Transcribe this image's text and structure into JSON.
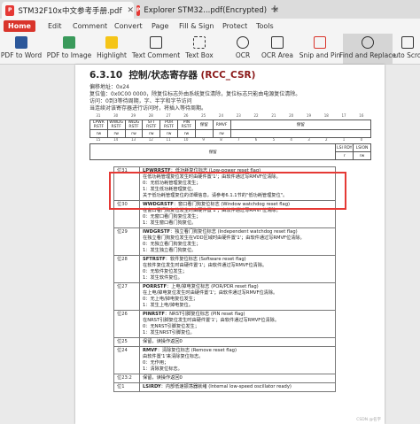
{
  "tabs": [
    {
      "label": "STM32F10x中文参考手册.pdf",
      "icon": "pdf-icon"
    },
    {
      "label": "Explorer STM32...pdf(Encrypted)",
      "icon": "pdf-icon"
    }
  ],
  "new_tab": "+",
  "menu": [
    "Home",
    "Edit",
    "Comment",
    "Convert",
    "Page",
    "Fill & Sign",
    "Protect",
    "Tools"
  ],
  "toolbar": [
    "PDF to Word",
    "PDF to Image",
    "Highlight",
    "Text Comment",
    "Text Box",
    "OCR",
    "OCR Area",
    "Snip and Pin",
    "Find and Replace",
    "Auto Scroll"
  ],
  "doc": {
    "section_num": "6.3.10",
    "section_title": "控制/状态寄存器",
    "section_reg": "(RCC_CSR)",
    "offset": "偏移地址：0x24",
    "reset": "复位值：0x0C00 0000，除复位标志外由系统复位清除，复位标志只能由电源复位清除。",
    "access": "访问：0到3等待周期，字、半字和字节访问",
    "note": "当连续对该寄存器进行访问时，将插入等待周期。",
    "bits_top": [
      "31",
      "30",
      "29",
      "28",
      "27",
      "26",
      "25",
      "24",
      "23",
      "22",
      "21",
      "20",
      "19",
      "18",
      "17",
      "16"
    ],
    "row1": [
      "LPWR RSTF",
      "WWDG RSTF",
      "IWDG RSTF",
      "SFT RSTF",
      "POR RSTF",
      "PIN RSTF",
      "保留",
      "RMVF",
      "保留"
    ],
    "row1_access": [
      "rw",
      "rw",
      "rw",
      "rw",
      "rw",
      "rw",
      "",
      "rw",
      ""
    ],
    "bits_bot": [
      "15",
      "14",
      "13",
      "12",
      "11",
      "10",
      "9",
      "8",
      "7",
      "6",
      "5",
      "4",
      "3",
      "2",
      "1",
      "0"
    ],
    "row2": [
      "保留",
      "LSI RDY",
      "LSION"
    ],
    "row2_access": [
      "",
      "r",
      "rw"
    ],
    "fields": [
      {
        "bit": "位31",
        "name": "LPWRRSTF",
        "lines": [
          "低功耗复位标志 (Low-power reset flag)",
          "在低功耗管理复位发生时由硬件置'1'；由软件通过写RMVF位清除。",
          "0：无低功耗管理复位发生；",
          "1：发生低功耗管理复位。",
          "关于低功耗管理复位的详细信息，请参考6.1.1节的\"低功耗管理复位\"。"
        ]
      },
      {
        "bit": "位30",
        "name": "WWDGRSTF",
        "lines": [
          "窗口看门狗复位标志 (Window watchdog reset flag)",
          "在窗口看门狗复位发生时由硬件置'1'；由软件通过写RMVF位清除。",
          "0：无窗口看门狗复位发生；",
          "1：发生窗口看门狗复位。"
        ]
      },
      {
        "bit": "位29",
        "name": "IWDGRSTF",
        "lines": [
          "独立看门狗复位标志 (Independent watchdog reset flag)",
          "在独立看门狗复位发生在VDD区域时由硬件置'1'；由软件通过写RMVF位清除。",
          "0：无独立看门狗复位发生；",
          "1：发生独立看门狗复位。"
        ]
      },
      {
        "bit": "位28",
        "name": "SFTRSTF",
        "lines": [
          "软件复位标志 (Software reset flag)",
          "在软件复位发生时由硬件置'1'；由软件通过写RMVF位清除。",
          "0：无软件复位发生；",
          "1：发生软件复位。"
        ]
      },
      {
        "bit": "位27",
        "name": "PORRSTF",
        "lines": [
          "上电/掉电复位标志 (POR/PDR reset flag)",
          "在上电/掉电复位发生时由硬件置'1'；由软件通过写RMVF位清除。",
          "0：无上电/掉电复位发生；",
          "1：发生上电/掉电复位。"
        ]
      },
      {
        "bit": "位26",
        "name": "PINRSTF",
        "lines": [
          "NRST引脚复位标志 (PIN reset flag)",
          "在NRST引脚复位发生时由硬件置'1'；由软件通过写RMVF位清除。",
          "0：无NRST引脚复位发生；",
          "1：发生NRST引脚复位。"
        ]
      },
      {
        "bit": "位25",
        "name": "",
        "lines": [
          "保留，读操作返回0"
        ]
      },
      {
        "bit": "位24",
        "name": "RMVF",
        "lines": [
          "清除复位标志 (Remove reset flag)",
          "由软件置'1'来清除复位标志。",
          "0：无作用；",
          "1：清除复位标志。"
        ]
      },
      {
        "bit": "位23:2",
        "name": "",
        "lines": [
          "保留，读操作返回0"
        ]
      },
      {
        "bit": "位1",
        "name": "LSIRDY",
        "lines": [
          "内部低速振荡器就绪 (Internal low-speed oscillator ready)"
        ]
      }
    ],
    "watermark": "CSDN @名字"
  }
}
